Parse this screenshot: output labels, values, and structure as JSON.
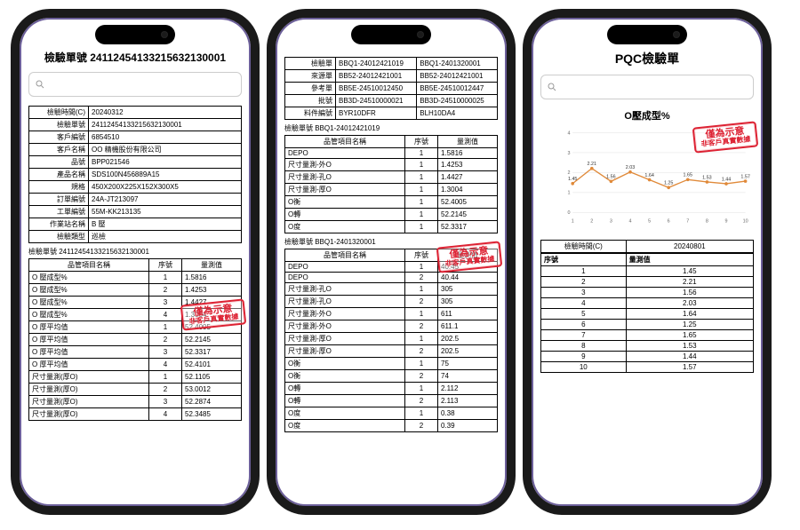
{
  "stamp": {
    "main": "僅為示意",
    "sub": "非客戶真實數據"
  },
  "phone1": {
    "title": "檢驗單號 24112454133215632130001",
    "kv": [
      [
        "檢驗時間(C)",
        "20240312"
      ],
      [
        "檢驗單號",
        "24112454133215632130001"
      ],
      [
        "客戶編號",
        "6854510"
      ],
      [
        "客戶名稱",
        "OO 精機股份有限公司"
      ],
      [
        "品號",
        "BPP021546"
      ],
      [
        "產品名稱",
        "SDS100N456889A15"
      ],
      [
        "規格",
        "450X200X225X152X300X5"
      ],
      [
        "訂單編號",
        "24A-JT213097"
      ],
      [
        "工單編號",
        "55M-KK213135"
      ],
      [
        "作業站名稱",
        "B 壓"
      ],
      [
        "檢驗類型",
        "巡檢"
      ]
    ],
    "section": "檢驗單號 24112454133215632130001",
    "headers": [
      "品管項目名稱",
      "序號",
      "量測值"
    ],
    "rows": [
      [
        "O 壓成型%",
        "1",
        "1.5816"
      ],
      [
        "O 壓成型%",
        "2",
        "1.4253"
      ],
      [
        "O 壓成型%",
        "3",
        "1.4427"
      ],
      [
        "O 壓成型%",
        "4",
        "1.3004"
      ],
      [
        "O 厚平均值",
        "1",
        "52.4005"
      ],
      [
        "O 厚平均值",
        "2",
        "52.2145"
      ],
      [
        "O 厚平均值",
        "3",
        "52.3317"
      ],
      [
        "O 厚平均值",
        "4",
        "52.4101"
      ],
      [
        "尺寸量測(厚O)",
        "1",
        "52.1105"
      ],
      [
        "尺寸量測(厚O)",
        "2",
        "53.0012"
      ],
      [
        "尺寸量測(厚O)",
        "3",
        "52.2874"
      ],
      [
        "尺寸量測(厚O)",
        "4",
        "52.3485"
      ]
    ]
  },
  "phone2": {
    "pair": [
      [
        "檢驗單",
        "BBQ1-24012421019",
        "BBQ1-2401320001"
      ],
      [
        "來源單",
        "BB52-24012421001",
        "BB52-24012421001"
      ],
      [
        "參考單",
        "BB5E-24510012450",
        "BB5E-24510012447"
      ],
      [
        "批號",
        "BB3D-24510000021",
        "BB3D-24510000025"
      ],
      [
        "料件編號",
        "BYR10DFR",
        "BLH10DA4"
      ]
    ],
    "sectionA": "檢驗單號 BBQ1-24012421019",
    "tableA": {
      "headers": [
        "品管項目名稱",
        "序號",
        "量測值"
      ],
      "rows": [
        [
          "DEPO",
          "1",
          "1.5816"
        ],
        [
          "尺寸量測-外O",
          "1",
          "1.4253"
        ],
        [
          "尺寸量測-孔O",
          "1",
          "1.4427"
        ],
        [
          "尺寸量測-厚O",
          "1",
          "1.3004"
        ],
        [
          "O衡",
          "1",
          "52.4005"
        ],
        [
          "O轉",
          "1",
          "52.2145"
        ],
        [
          "O度",
          "1",
          "52.3317"
        ]
      ]
    },
    "sectionB": "檢驗單號 BBQ1-2401320001",
    "tableB": {
      "headers": [
        "品管項目名稱",
        "序號",
        "量測值"
      ],
      "rows": [
        [
          "DEPO",
          "1",
          "40.45"
        ],
        [
          "DEPO",
          "2",
          "40.44"
        ],
        [
          "尺寸量測-孔O",
          "1",
          "305"
        ],
        [
          "尺寸量測-孔O",
          "2",
          "305"
        ],
        [
          "尺寸量測-外O",
          "1",
          "611"
        ],
        [
          "尺寸量測-外O",
          "2",
          "611.1"
        ],
        [
          "尺寸量測-厚O",
          "1",
          "202.5"
        ],
        [
          "尺寸量測-厚O",
          "2",
          "202.5"
        ],
        [
          "O衡",
          "1",
          "75"
        ],
        [
          "O衡",
          "2",
          "74"
        ],
        [
          "O轉",
          "1",
          "2.112"
        ],
        [
          "O轉",
          "2",
          "2.113"
        ],
        [
          "O度",
          "1",
          "0.38"
        ],
        [
          "O度",
          "2",
          "0.39"
        ]
      ]
    }
  },
  "phone3": {
    "title": "PQC檢驗單",
    "chart_label": "O壓成型%",
    "kv_top": [
      "檢驗時間(C)",
      "20240801"
    ],
    "headers": [
      "序號",
      "量測值"
    ],
    "rows": [
      [
        "1",
        "1.45"
      ],
      [
        "2",
        "2.21"
      ],
      [
        "3",
        "1.56"
      ],
      [
        "4",
        "2.03"
      ],
      [
        "5",
        "1.64"
      ],
      [
        "6",
        "1.25"
      ],
      [
        "7",
        "1.65"
      ],
      [
        "8",
        "1.53"
      ],
      [
        "9",
        "1.44"
      ],
      [
        "10",
        "1.57"
      ]
    ]
  },
  "chart_data": {
    "type": "line",
    "title": "O壓成型%",
    "xlabel": "",
    "ylabel": "",
    "x": [
      1,
      2,
      3,
      4,
      5,
      6,
      7,
      8,
      9,
      10
    ],
    "values": [
      1.45,
      2.21,
      1.56,
      2.03,
      1.64,
      1.25,
      1.65,
      1.53,
      1.44,
      1.57
    ],
    "ylim": [
      0,
      4
    ],
    "yticks": [
      0,
      1,
      2,
      3,
      4
    ]
  }
}
